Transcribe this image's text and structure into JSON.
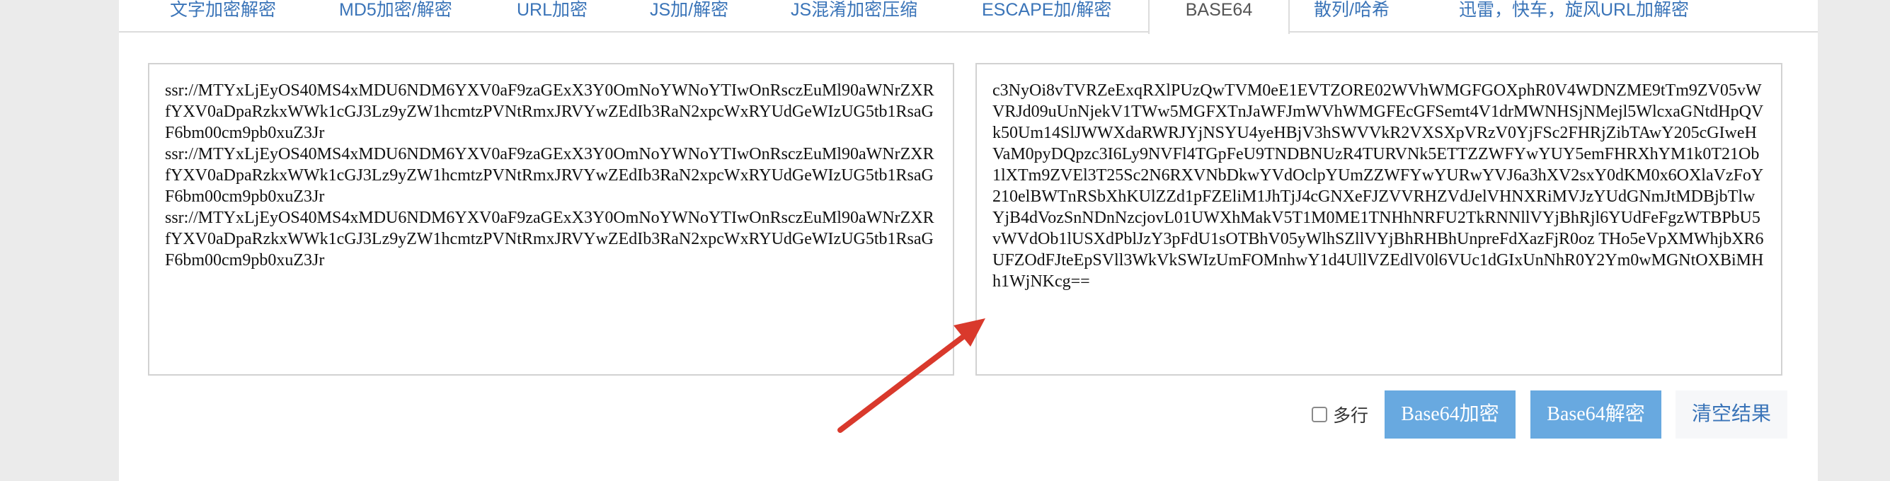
{
  "tabs": [
    {
      "label": "文字加密解密",
      "active": false
    },
    {
      "label": "MD5加密/解密",
      "active": false
    },
    {
      "label": "URL加密",
      "active": false
    },
    {
      "label": "JS加/解密",
      "active": false
    },
    {
      "label": "JS混淆加密压缩",
      "active": false
    },
    {
      "label": "ESCAPE加/解密",
      "active": false
    },
    {
      "label": "BASE64",
      "active": true
    },
    {
      "label": "散列/哈希",
      "active": false
    },
    {
      "label": "迅雷，快车，旋风URL加解密",
      "active": false
    }
  ],
  "input": {
    "value": "ssr://MTYxLjEyOS40MS4xMDU6NDM6YXV0aF9zaGExX3Y0OmNoYWNoYTIwOnRsczEuMl90aWNrZXRfYXV0aDpaRzkxWWk1cGJ3Lz9yZW1hcmtzPVNtRmxJRVYwZEdIb3RaN2xpcWxRYUdGeWIzUG5tb1RsaGF6bm00cm9pb0xuZ3Jr\nssr://MTYxLjEyOS40MS4xMDU6NDM6YXV0aF9zaGExX3Y0OmNoYWNoYTIwOnRsczEuMl90aWNrZXRfYXV0aDpaRzkxWWk1cGJ3Lz9yZW1hcmtzPVNtRmxJRVYwZEdIb3RaN2xpcWxRYUdGeWIzUG5tb1RsaGF6bm00cm9pb0xuZ3Jr\nssr://MTYxLjEyOS40MS4xMDU6NDM6YXV0aF9zaGExX3Y0OmNoYWNoYTIwOnRsczEuMl90aWNrZXRfYXV0aDpaRzkxWWk1cGJ3Lz9yZW1hcmtzPVNtRmxJRVYwZEdIb3RaN2xpcWxRYUdGeWIzUG5tb1RsaGF6bm00cm9pb0xuZ3Jr"
  },
  "output": {
    "value": "c3NyOi8vTVRZeExqRXlPUzQwTVM0eE1EVTZORE02WVhWMGFGOXphR0V4WDNZME9tTm9ZV05vWVRJd09uUnNjekV1TWw5MGFXTnJaWFJmWVhWMGFEcGFSemt4V1drMWNHSjNMejl5WlcxaGNtdHpQVk50Um14SlJWWXdaRWRJYjNSYU4yeHBjV3hSWVVkR2VXSXpVRzV0YjFSc2FHRjZibTAwY205cGIweHVaM0pyDQpzc3I6Ly9NVFl4TGpFeU9TNDBNUzR4TURVNk5ETTZZWFYwYUY5emFHRXhYM1k0T21Ob1lXTm9ZVEl3T25Sc2N6RXVNbDkwYVdOclpYUmZZWFYwYURwYVJ6a3hXV2sxY0dKM0x6OXlaVzFoY210elBWTnRSbXhKUlZZd1pFZEliM1JhTjJ4cGNXeFJZVVRHZVdJelVHNXRiMVJzYUdGNmJtMDBjbTlwYjB4dVozSnNDnNzcjovL01UWXhMakV5T1M0ME1TNHhNRFU2TkRNNllVYjBhRjl6YUdFeFgzWTBPbU5vWVdOb1lUSXdPblJzY3pFdU1sOTBhV05yWlhSZllVYjBhRHBhUnpreFdXazFjR0oz THo5eVpXMWhjbXR6UFZOdFJteEpSVll3WkVkSWIzUmFOMnhwY1d4UllVZEdlV0l6VUc1dGIxUnNhR0Y2Ym0wMGNtOXBiMHh1WjNKcg=="
  },
  "controls": {
    "multiline_label": "多行",
    "multiline_checked": false,
    "encode_label": "Base64加密",
    "decode_label": "Base64解密",
    "clear_label": "清空结果"
  },
  "colors": {
    "tab_link": "#3a74b8",
    "primary_button": "#68a9e0",
    "annotation_arrow": "#d9392c"
  }
}
